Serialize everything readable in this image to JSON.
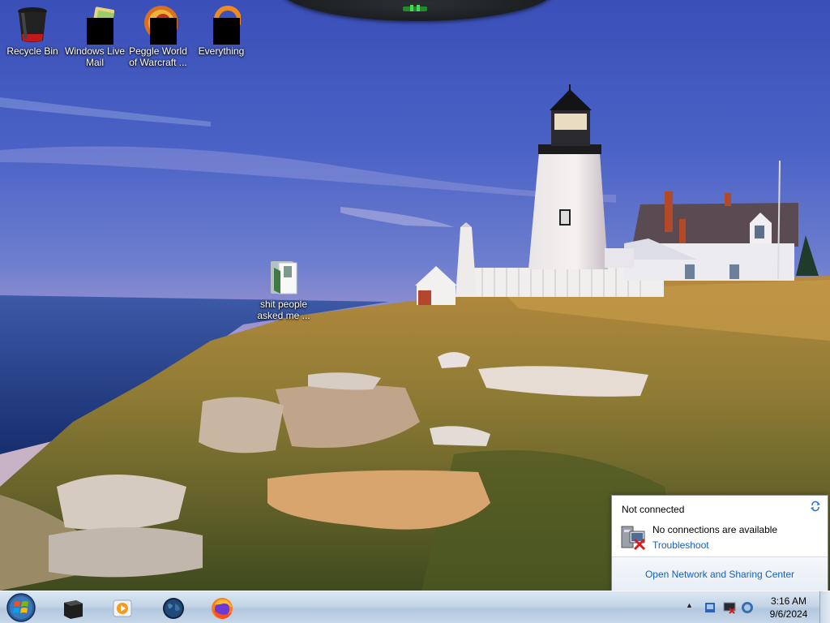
{
  "desktop": {
    "icons": [
      {
        "label": "Recycle Bin",
        "icon": "recycle-bin-icon"
      },
      {
        "label": "Windows Live Mail",
        "icon": "windows-live-mail-icon"
      },
      {
        "label": "Peggle World of Warcraft ...",
        "icon": "peggle-icon"
      },
      {
        "label": "Everything",
        "icon": "everything-search-icon"
      },
      {
        "label": "shit people asked me ...",
        "icon": "folder-icon"
      }
    ]
  },
  "network_popup": {
    "status": "Not connected",
    "message": "No connections are available",
    "troubleshoot": "Troubleshoot",
    "open_center": "Open Network and Sharing Center"
  },
  "taskbar": {
    "pinned": [
      {
        "name": "windows-explorer",
        "icon": "file-explorer-icon"
      },
      {
        "name": "windows-media-player",
        "icon": "media-player-icon"
      },
      {
        "name": "internet",
        "icon": "globe-icon"
      },
      {
        "name": "firefox",
        "icon": "firefox-icon"
      }
    ],
    "clock": {
      "time": "3:16 AM",
      "date": "9/6/2024"
    }
  },
  "colors": {
    "taskbar": "#c3d4e6",
    "link": "#1560b8",
    "sky": "#4a62c6",
    "sea": "#1f3a7a"
  }
}
